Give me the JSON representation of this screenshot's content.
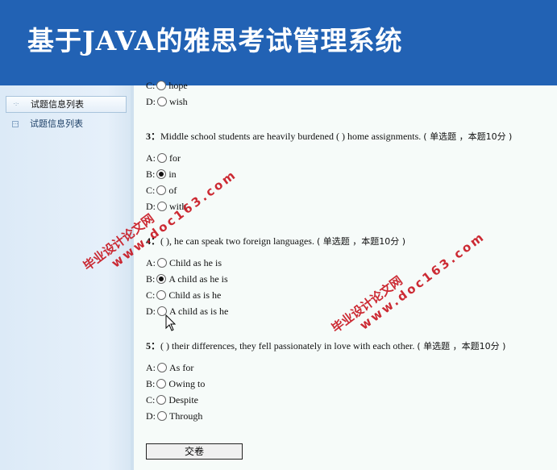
{
  "header": {
    "title": "基于JAVA的雅思考试管理系统"
  },
  "sidebar": {
    "items": [
      {
        "label": "试题信息列表",
        "active": true
      },
      {
        "label": "试题信息列表",
        "active": false
      }
    ]
  },
  "questions": [
    {
      "partial": true,
      "options": [
        {
          "key": "C:",
          "text": "hope",
          "checked": false
        },
        {
          "key": "D:",
          "text": "wish",
          "checked": false
        }
      ]
    },
    {
      "num": "3：",
      "text": "Middle school students are heavily burdened ( ) home assignments.",
      "meta": "( 单选题 ，本题10分 )",
      "options": [
        {
          "key": "A:",
          "text": "for",
          "checked": false
        },
        {
          "key": "B:",
          "text": "in",
          "checked": true
        },
        {
          "key": "C:",
          "text": "of",
          "checked": false
        },
        {
          "key": "D:",
          "text": "with",
          "checked": false
        }
      ]
    },
    {
      "num": "4：",
      "text": "( ), he can speak two foreign languages.",
      "meta": "( 单选题 ，本题10分 )",
      "options": [
        {
          "key": "A:",
          "text": "Child as he is",
          "checked": false
        },
        {
          "key": "B:",
          "text": "A child as he is",
          "checked": true
        },
        {
          "key": "C:",
          "text": "Child as is he",
          "checked": false
        },
        {
          "key": "D:",
          "text": "A child as is he",
          "checked": false
        }
      ]
    },
    {
      "num": "5：",
      "text": "( ) their differences, they fell passionately in love with each other.",
      "meta": "( 单选题 ，本题10分 )",
      "options": [
        {
          "key": "A:",
          "text": "As for",
          "checked": false
        },
        {
          "key": "B:",
          "text": "Owing to",
          "checked": false
        },
        {
          "key": "C:",
          "text": "Despite",
          "checked": false
        },
        {
          "key": "D:",
          "text": "Through",
          "checked": false
        }
      ]
    }
  ],
  "submit_label": "交卷",
  "watermark": {
    "line1": "毕业设计论文网",
    "line2": "www.doc163.com",
    "color": "#c8141e"
  }
}
